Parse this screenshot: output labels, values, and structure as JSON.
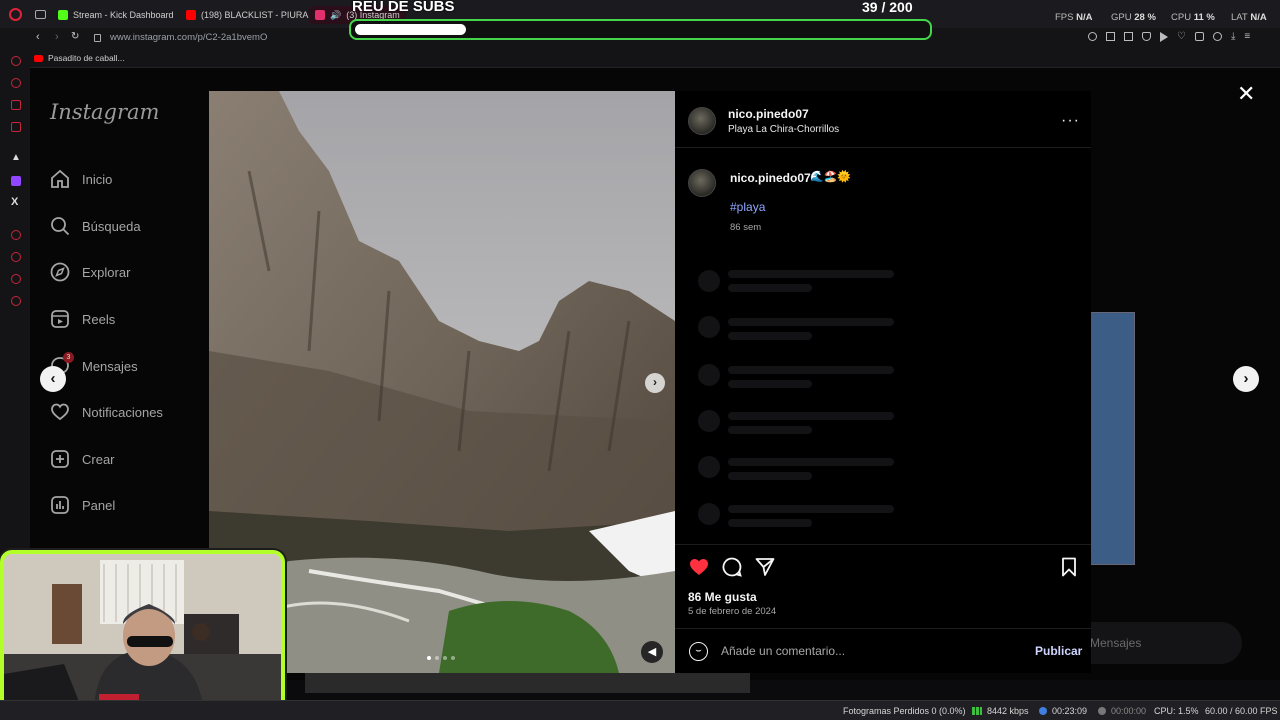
{
  "browser": {
    "tabs": [
      {
        "label": "Stream - Kick Dashboard",
        "color": "#53fc18"
      },
      {
        "label": "(198) BLACKLIST - PIURA",
        "color": "#ff0000"
      },
      {
        "label": "(3) Instagram",
        "color": "#e1306c"
      }
    ],
    "url": "www.instagram.com/p/C2-2a1bvemO",
    "bookmark": "Pasadito de caball...",
    "stats": {
      "fps_label": "FPS",
      "fps_value": "N/A",
      "gpu_label": "GPU",
      "gpu_value": "28 %",
      "cpu_label": "CPU",
      "cpu_value": "11 %",
      "lat_label": "LAT",
      "lat_value": "N/A"
    }
  },
  "overlay": {
    "subs_title": "REU DE SUBS",
    "subs_count": "39  / 200",
    "subs_current": 39,
    "subs_goal": 200,
    "accent": "#44d64a"
  },
  "instagram": {
    "logo": "Instagram",
    "nav": [
      {
        "label": "Inicio",
        "icon": "home-icon"
      },
      {
        "label": "Búsqueda",
        "icon": "search-icon"
      },
      {
        "label": "Explorar",
        "icon": "compass-icon"
      },
      {
        "label": "Reels",
        "icon": "reels-icon"
      },
      {
        "label": "Mensajes",
        "icon": "messenger-icon"
      },
      {
        "label": "Notificaciones",
        "icon": "heart-icon"
      },
      {
        "label": "Crear",
        "icon": "plus-square-icon"
      },
      {
        "label": "Panel",
        "icon": "dashboard-icon"
      }
    ],
    "messages_badge": "3",
    "background_messages": "Mensajes"
  },
  "post": {
    "username": "nico.pinedo07",
    "location": "Playa La Chira-Chorrillos",
    "caption_user": "nico.pinedo07",
    "caption_emojis": "🌊🏖️🌞",
    "hashtag": "#playa",
    "time_ago": "86 sem",
    "likes": "86 Me gusta",
    "date": "5 de febrero de 2024",
    "comment_placeholder": "Añade un comentario...",
    "publish_label": "Publicar",
    "liked": true,
    "like_color": "#ff3040"
  },
  "obs": {
    "dropped": "Fotogramas Perdidos 0 (0.0%)",
    "bitrate": "8442 kbps",
    "stream_time": "00:23:09",
    "rec_time": "00:00:00",
    "cpu": "CPU: 1.5%",
    "fps": "60.00 / 60.00 FPS"
  }
}
